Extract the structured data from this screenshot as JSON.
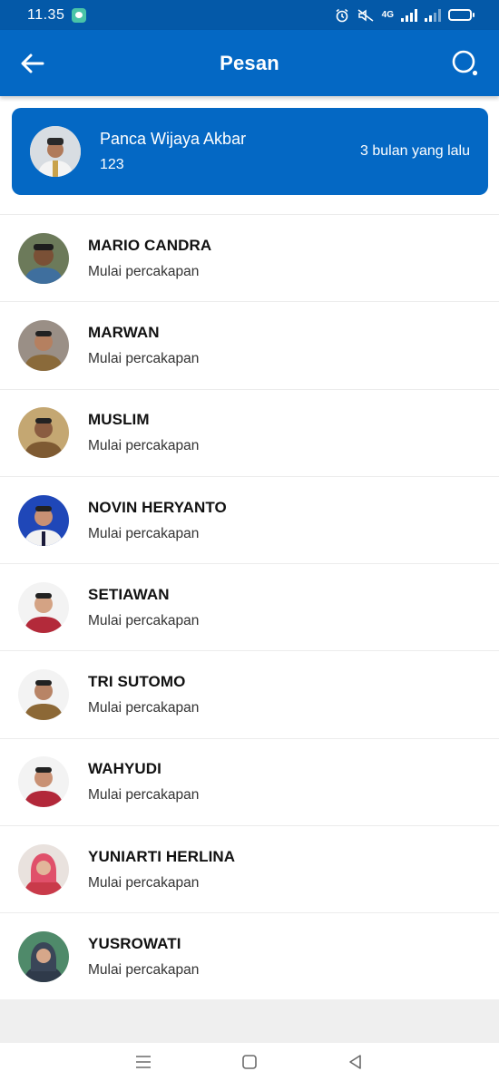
{
  "status_bar": {
    "time": "11.35",
    "network": "4G"
  },
  "app_bar": {
    "title": "Pesan",
    "back_icon": "arrow-left-icon",
    "search_icon": "search-icon"
  },
  "colors": {
    "primary": "#0468c4",
    "status_bar": "#0459a8",
    "background": "#ffffff"
  },
  "pinned": {
    "name": "Panca Wijaya Akbar",
    "message": "123",
    "time": "3 bulan yang lalu"
  },
  "contacts": [
    {
      "name": "MARIO CANDRA",
      "subtitle": "Mulai percakapan"
    },
    {
      "name": "MARWAN",
      "subtitle": "Mulai percakapan"
    },
    {
      "name": "MUSLIM",
      "subtitle": "Mulai percakapan"
    },
    {
      "name": "NOVIN HERYANTO",
      "subtitle": "Mulai percakapan"
    },
    {
      "name": "SETIAWAN",
      "subtitle": "Mulai percakapan"
    },
    {
      "name": "TRI SUTOMO",
      "subtitle": "Mulai percakapan"
    },
    {
      "name": "WAHYUDI",
      "subtitle": "Mulai percakapan"
    },
    {
      "name": "YUNIARTI HERLINA",
      "subtitle": "Mulai percakapan"
    },
    {
      "name": "YUSROWATI",
      "subtitle": "Mulai percakapan"
    }
  ],
  "nav_bar": {
    "menu_icon": "menu-icon",
    "home_icon": "home-square-icon",
    "back_icon": "back-triangle-icon"
  }
}
